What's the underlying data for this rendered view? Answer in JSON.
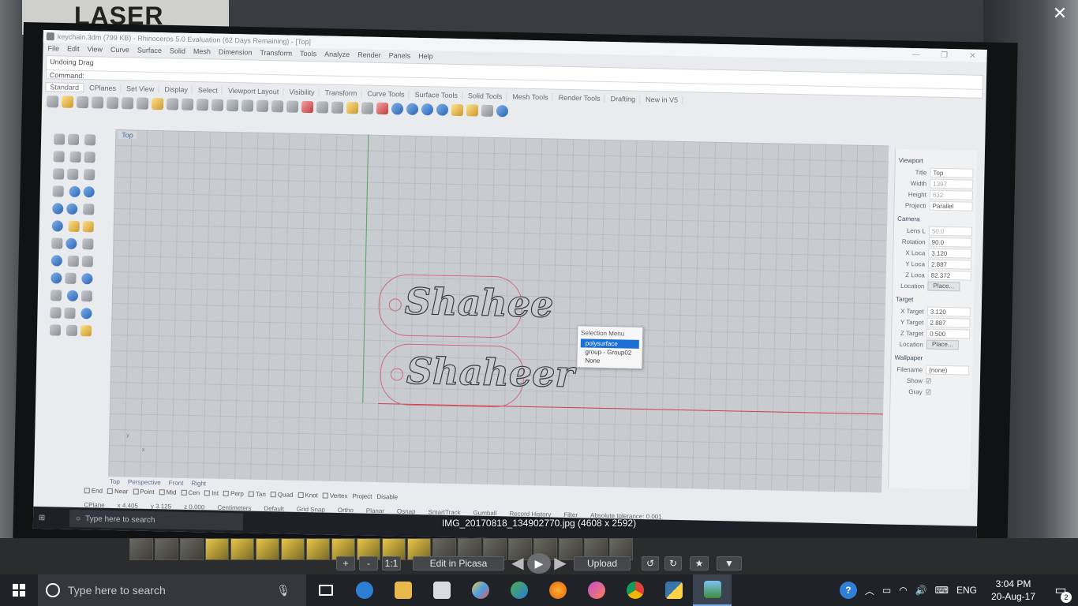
{
  "photo": {
    "sign_text": "LASER"
  },
  "rhino": {
    "window_title": "keychain.3dm (799 KB) - Rhinoceros 5.0 Evaluation (62 Days Remaining) - [Top]",
    "menu": [
      "File",
      "Edit",
      "View",
      "Curve",
      "Surface",
      "Solid",
      "Mesh",
      "Dimension",
      "Transform",
      "Tools",
      "Analyze",
      "Render",
      "Panels",
      "Help"
    ],
    "history_line": "Undoing Drag",
    "command_label": "Command:",
    "toolbar_tabs": [
      "Standard",
      "CPlanes",
      "Set View",
      "Display",
      "Select",
      "Viewport Layout",
      "Visibility",
      "Transform",
      "Curve Tools",
      "Surface Tools",
      "Solid Tools",
      "Mesh Tools",
      "Render Tools",
      "Drafting",
      "New in V5"
    ],
    "viewport_label": "Top",
    "keychain_text_1": "Shahee",
    "keychain_text_2": "Shaheer",
    "axis_label_x": "x",
    "axis_label_y": "y",
    "selection_menu": {
      "title": "Selection Menu",
      "options": [
        "polysurface",
        "group - Group02",
        "None"
      ]
    },
    "viewport_tabs": [
      "Top",
      "Perspective",
      "Front",
      "Right"
    ],
    "osnaps": [
      "End",
      "Near",
      "Point",
      "Mid",
      "Cen",
      "Int",
      "Perp",
      "Tan",
      "Quad",
      "Knot",
      "Vertex",
      "Project",
      "Disable"
    ],
    "status": {
      "cplane": "CPlane",
      "x": "x 4.405",
      "y": "y 3.125",
      "z": "z 0.000",
      "units": "Centimeters",
      "layer": "Default",
      "toggles": [
        "Grid Snap",
        "Ortho",
        "Planar",
        "Osnap",
        "SmartTrack",
        "Gumball",
        "Record History",
        "Filter",
        "Absolute tolerance: 0.001"
      ]
    },
    "properties": {
      "viewport_header": "Viewport",
      "title_label": "Title",
      "title_value": "Top",
      "width_label": "Width",
      "width_value": "1397",
      "height_label": "Height",
      "height_value": "632",
      "projection_label": "Projecti",
      "projection_value": "Parallel",
      "camera_header": "Camera",
      "lens_label": "Lens L",
      "lens_value": "50.0",
      "rotation_label": "Rotation",
      "rotation_value": "90.0",
      "xloc_label": "X Loca",
      "xloc_value": "3.120",
      "yloc_label": "Y Loca",
      "yloc_value": "2.887",
      "zloc_label": "Z Loca",
      "zloc_value": "82.372",
      "location_label": "Location",
      "place_button": "Place...",
      "target_header": "Target",
      "xt_label": "X Target",
      "xt_value": "3.120",
      "yt_label": "Y Target",
      "yt_value": "2.887",
      "zt_label": "Z Target",
      "zt_value": "0.500",
      "tloc_label": "Location",
      "tplace_button": "Place...",
      "wallpaper_header": "Wallpaper",
      "filename_label": "Filename",
      "filename_value": "(none)",
      "show_label": "Show",
      "gray_label": "Gray"
    },
    "inner_search_placeholder": "Type here to search"
  },
  "picasa": {
    "file_title": "IMG_20170818_134902770.jpg (4608 x 2592)",
    "zoom_in": "+",
    "zoom_out": "-",
    "actual_size": "1:1",
    "edit_button": "Edit in Picasa",
    "upload_button": "Upload",
    "rotate_left": "↺",
    "rotate_right": "↻",
    "star": "★",
    "more": "▼",
    "close": "✕"
  },
  "taskbar": {
    "search_placeholder": "Type here to search",
    "time": "3:04 PM",
    "date": "20-Aug-17",
    "language": "ENG",
    "notification_count": "2",
    "help": "?"
  }
}
